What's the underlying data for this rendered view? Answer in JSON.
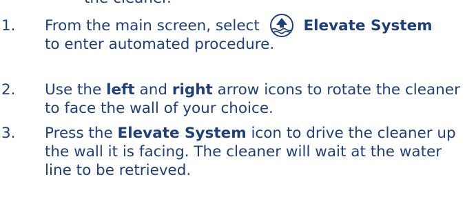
{
  "header": {
    "clipped_text": "the cleaner."
  },
  "steps": [
    {
      "number": "1.",
      "line1_before_icon": "From the main screen, select",
      "icon": "elevate-system-icon",
      "line1_bold": "Elevate System",
      "line2": "to enter automated procedure."
    },
    {
      "number": "2.",
      "line1_a": "Use the ",
      "line1_bold_left": "left",
      "line1_b": " and ",
      "line1_bold_right": "right",
      "line1_c": " arrow icons to rotate the cleaner",
      "line2": "to face the wall of your choice."
    },
    {
      "number": "3.",
      "line1_a": "Press the ",
      "line1_bold": "Elevate System",
      "line1_b": " icon to drive the cleaner up",
      "line2": "the wall it is facing. The cleaner will wait at the water",
      "line3": "line to be retrieved."
    }
  ],
  "colors": {
    "text": "#1d3f7a"
  }
}
